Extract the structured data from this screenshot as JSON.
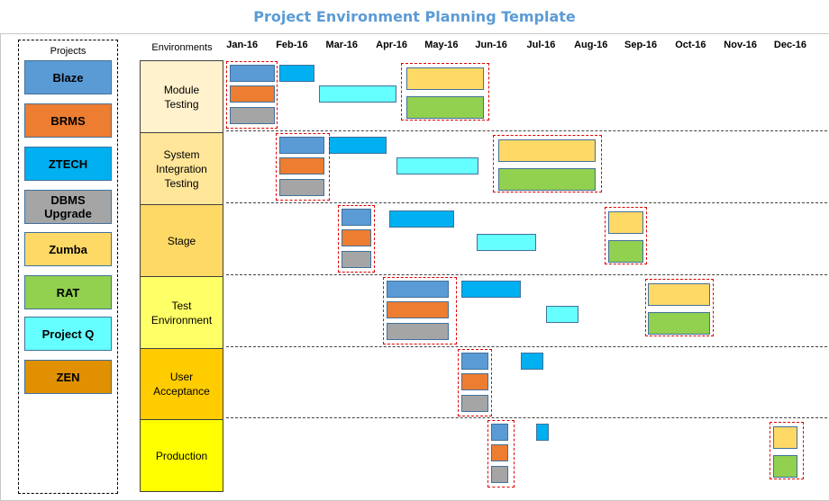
{
  "title": "Project Environment Planning Template",
  "legend": {
    "title": "Projects",
    "items": [
      {
        "key": "blaze",
        "label": "Blaze",
        "color": "#5b9bd5"
      },
      {
        "key": "brms",
        "label": "BRMS",
        "color": "#ed7d31"
      },
      {
        "key": "ztech",
        "label": "ZTECH",
        "color": "#00b0f0"
      },
      {
        "key": "dbms",
        "label": "DBMS\nUpgrade",
        "color": "#a5a5a5"
      },
      {
        "key": "zumba",
        "label": "Zumba",
        "color": "#ffd966"
      },
      {
        "key": "rat",
        "label": "RAT",
        "color": "#92d050"
      },
      {
        "key": "projectq",
        "label": "Project Q",
        "color": "#66ffff"
      },
      {
        "key": "zen",
        "label": "ZEN",
        "color": "#e09000"
      }
    ]
  },
  "chart_data": {
    "type": "gantt",
    "title": "Project Environment Planning Template",
    "x_axis": {
      "label": "",
      "ticks": [
        "Jan-16",
        "Feb-16",
        "Mar-16",
        "Apr-16",
        "May-16",
        "Jun-16",
        "Jul-16",
        "Aug-16",
        "Sep-16",
        "Oct-16",
        "Nov-16",
        "Dec-16"
      ],
      "range_months": [
        0,
        12
      ]
    },
    "y_axis": {
      "label": "Environments",
      "categories": [
        {
          "label": "Module\nTesting",
          "color": "#fff2cc"
        },
        {
          "label": "System\nIntegration\nTesting",
          "color": "#ffe699"
        },
        {
          "label": "Stage",
          "color": "#ffd966"
        },
        {
          "label": "Test\nEnvironment",
          "color": "#ffff66"
        },
        {
          "label": "User\nAcceptance",
          "color": "#ffcc00"
        },
        {
          "label": "Production",
          "color": "#ffff00"
        }
      ]
    },
    "tasks": [
      {
        "env": 0,
        "project": "blaze",
        "start": 0.05,
        "end": 0.95,
        "lane": 0,
        "lanes": 3
      },
      {
        "env": 0,
        "project": "brms",
        "start": 0.05,
        "end": 0.95,
        "lane": 1,
        "lanes": 3
      },
      {
        "env": 0,
        "project": "dbms",
        "start": 0.05,
        "end": 0.95,
        "lane": 2,
        "lanes": 3
      },
      {
        "env": 0,
        "project": "ztech",
        "start": 1.05,
        "end": 1.75,
        "lane": 0,
        "lanes": 3
      },
      {
        "env": 0,
        "project": "projectq",
        "start": 1.85,
        "end": 3.4,
        "lane": 1,
        "lanes": 3
      },
      {
        "env": 0,
        "project": "zumba",
        "start": 3.6,
        "end": 5.15,
        "lane": 0.1,
        "lanes": 2.4
      },
      {
        "env": 0,
        "project": "rat",
        "start": 3.6,
        "end": 5.15,
        "lane": 1.2,
        "lanes": 2.4
      },
      {
        "env": 1,
        "project": "blaze",
        "start": 1.05,
        "end": 1.95,
        "lane": 0,
        "lanes": 3
      },
      {
        "env": 1,
        "project": "brms",
        "start": 1.05,
        "end": 1.95,
        "lane": 1,
        "lanes": 3
      },
      {
        "env": 1,
        "project": "dbms",
        "start": 1.05,
        "end": 1.95,
        "lane": 2,
        "lanes": 3
      },
      {
        "env": 1,
        "project": "ztech",
        "start": 2.05,
        "end": 3.2,
        "lane": 0,
        "lanes": 3
      },
      {
        "env": 1,
        "project": "projectq",
        "start": 3.4,
        "end": 5.05,
        "lane": 1,
        "lanes": 3
      },
      {
        "env": 1,
        "project": "zumba",
        "start": 5.45,
        "end": 7.4,
        "lane": 0.1,
        "lanes": 2.4
      },
      {
        "env": 1,
        "project": "rat",
        "start": 5.45,
        "end": 7.4,
        "lane": 1.2,
        "lanes": 2.4
      },
      {
        "env": 2,
        "project": "blaze",
        "start": 2.3,
        "end": 2.9,
        "lane": 0,
        "lanes": 3
      },
      {
        "env": 2,
        "project": "brms",
        "start": 2.3,
        "end": 2.9,
        "lane": 1,
        "lanes": 3
      },
      {
        "env": 2,
        "project": "dbms",
        "start": 2.3,
        "end": 2.9,
        "lane": 2,
        "lanes": 3
      },
      {
        "env": 2,
        "project": "ztech",
        "start": 3.25,
        "end": 4.55,
        "lane": 0.1,
        "lanes": 3
      },
      {
        "env": 2,
        "project": "projectq",
        "start": 5.0,
        "end": 6.2,
        "lane": 1.2,
        "lanes": 3
      },
      {
        "env": 2,
        "project": "zumba",
        "start": 7.65,
        "end": 8.35,
        "lane": 0.1,
        "lanes": 2.4
      },
      {
        "env": 2,
        "project": "rat",
        "start": 7.65,
        "end": 8.35,
        "lane": 1.2,
        "lanes": 2.4
      },
      {
        "env": 3,
        "project": "blaze",
        "start": 3.2,
        "end": 4.45,
        "lane": 0,
        "lanes": 3
      },
      {
        "env": 3,
        "project": "brms",
        "start": 3.2,
        "end": 4.45,
        "lane": 1,
        "lanes": 3
      },
      {
        "env": 3,
        "project": "dbms",
        "start": 3.2,
        "end": 4.45,
        "lane": 2,
        "lanes": 3
      },
      {
        "env": 3,
        "project": "ztech",
        "start": 4.7,
        "end": 5.9,
        "lane": 0,
        "lanes": 3
      },
      {
        "env": 3,
        "project": "projectq",
        "start": 6.4,
        "end": 7.05,
        "lane": 1.2,
        "lanes": 3
      },
      {
        "env": 3,
        "project": "zumba",
        "start": 8.45,
        "end": 9.7,
        "lane": 0.1,
        "lanes": 2.4
      },
      {
        "env": 3,
        "project": "rat",
        "start": 8.45,
        "end": 9.7,
        "lane": 1.2,
        "lanes": 2.4
      },
      {
        "env": 4,
        "project": "blaze",
        "start": 4.7,
        "end": 5.25,
        "lane": 0,
        "lanes": 3
      },
      {
        "env": 4,
        "project": "brms",
        "start": 4.7,
        "end": 5.25,
        "lane": 1,
        "lanes": 3
      },
      {
        "env": 4,
        "project": "dbms",
        "start": 4.7,
        "end": 5.25,
        "lane": 2,
        "lanes": 3
      },
      {
        "env": 4,
        "project": "ztech",
        "start": 5.9,
        "end": 6.35,
        "lane": 0,
        "lanes": 3
      },
      {
        "env": 5,
        "project": "blaze",
        "start": 5.3,
        "end": 5.65,
        "lane": 0,
        "lanes": 3
      },
      {
        "env": 5,
        "project": "brms",
        "start": 5.3,
        "end": 5.65,
        "lane": 1,
        "lanes": 3
      },
      {
        "env": 5,
        "project": "dbms",
        "start": 5.3,
        "end": 5.65,
        "lane": 2,
        "lanes": 3
      },
      {
        "env": 5,
        "project": "ztech",
        "start": 6.2,
        "end": 6.45,
        "lane": 0,
        "lanes": 3
      },
      {
        "env": 5,
        "project": "zumba",
        "start": 10.95,
        "end": 11.45,
        "lane": 0.1,
        "lanes": 2.4
      },
      {
        "env": 5,
        "project": "rat",
        "start": 10.95,
        "end": 11.45,
        "lane": 1.2,
        "lanes": 2.4
      }
    ],
    "highlight_groups": [
      {
        "env": 0,
        "start": 0.0,
        "end": 1.0,
        "projects": [
          "blaze",
          "brms",
          "dbms"
        ]
      },
      {
        "env": 0,
        "start": 3.5,
        "end": 5.25,
        "projects": [
          "zumba",
          "rat"
        ]
      },
      {
        "env": 1,
        "start": 1.0,
        "end": 2.05,
        "projects": [
          "blaze",
          "brms",
          "dbms"
        ]
      },
      {
        "env": 1,
        "start": 5.35,
        "end": 7.5,
        "projects": [
          "zumba",
          "rat"
        ]
      },
      {
        "env": 2,
        "start": 2.25,
        "end": 2.95,
        "projects": [
          "blaze",
          "brms",
          "dbms"
        ]
      },
      {
        "env": 2,
        "start": 7.6,
        "end": 8.4,
        "projects": [
          "zumba",
          "rat"
        ]
      },
      {
        "env": 3,
        "start": 3.15,
        "end": 4.6,
        "projects": [
          "blaze",
          "brms",
          "dbms"
        ]
      },
      {
        "env": 3,
        "start": 8.4,
        "end": 9.75,
        "projects": [
          "zumba",
          "rat"
        ]
      },
      {
        "env": 4,
        "start": 4.65,
        "end": 5.3,
        "projects": [
          "blaze",
          "brms",
          "dbms"
        ]
      },
      {
        "env": 5,
        "start": 5.25,
        "end": 5.75,
        "projects": [
          "blaze",
          "brms",
          "dbms"
        ]
      },
      {
        "env": 5,
        "start": 10.9,
        "end": 11.55,
        "projects": [
          "zumba",
          "rat"
        ]
      }
    ],
    "grid": false,
    "row_separators": "dashed",
    "legend_placement": "left"
  },
  "colors": {
    "title": "#5b9bd5",
    "highlight_border": "#e00000",
    "bar_border": "#41719c"
  }
}
